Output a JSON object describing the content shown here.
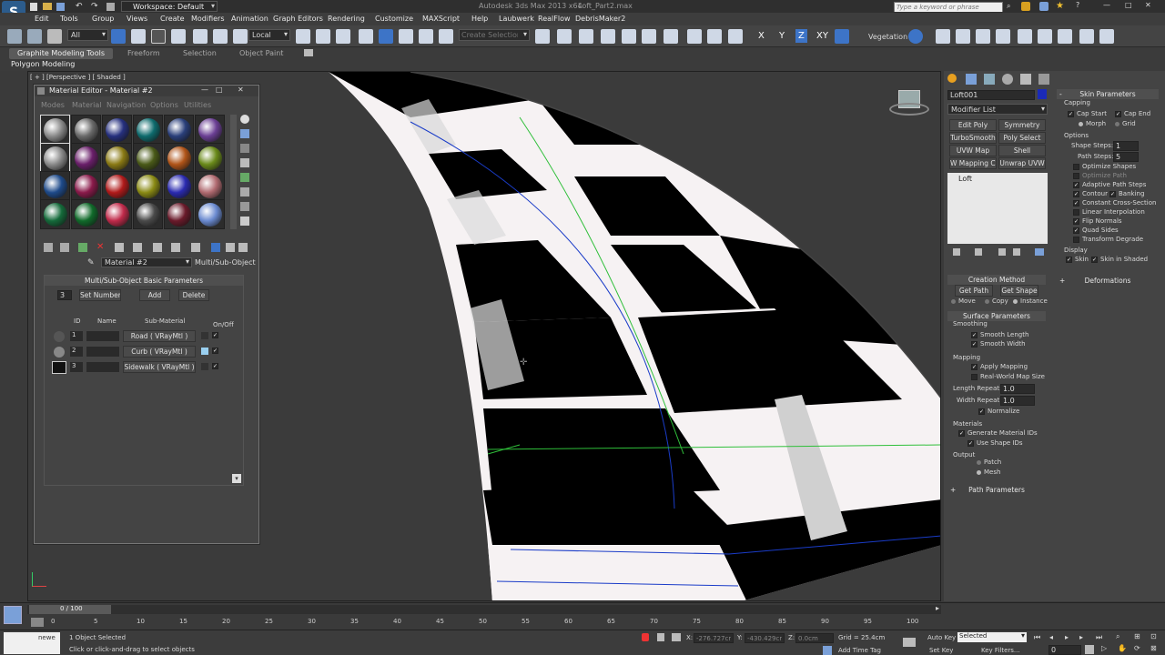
{
  "titlebar": {
    "workspace": "Workspace: Default",
    "app_title": "Autodesk 3ds Max  2013 x64",
    "file_name": "Loft_Part2.max",
    "search_placeholder": "Type a keyword or phrase"
  },
  "menu": [
    "Edit",
    "Tools",
    "Group",
    "Views",
    "Create",
    "Modifiers",
    "Animation",
    "Graph Editors",
    "Rendering",
    "Customize",
    "MAXScript",
    "Help",
    "Laubwerk",
    "RealFlow",
    "DebrisMaker2"
  ],
  "toolbar": {
    "selection_filter": "All",
    "ref_coord": "Local",
    "named_selection_placeholder": "Create Selection Se",
    "vegetation": "Vegetation",
    "axes": [
      "X",
      "Y",
      "Z",
      "XY"
    ]
  },
  "ribbon": {
    "tabs": [
      "Graphite Modeling Tools",
      "Freeform",
      "Selection",
      "Object Paint"
    ],
    "sub": "Polygon Modeling"
  },
  "viewport": {
    "label": "[ + ] [Perspective ] [ Shaded ]",
    "colors": {
      "dark": "#000000",
      "light": "#f6f2f3",
      "wire_blue": "#1a3cc8",
      "wire_green": "#2fbf3a"
    }
  },
  "material_editor": {
    "title": "Material Editor - Material #2",
    "menus": [
      "Modes",
      "Material",
      "Navigation",
      "Options",
      "Utilities"
    ],
    "material_name": "Material #2",
    "material_type": "Multi/Sub-Object",
    "rollout": "Multi/Sub-Object Basic Parameters",
    "count": "3",
    "set_number": "Set Number",
    "add": "Add",
    "delete": "Delete",
    "headers": {
      "id": "ID",
      "name": "Name",
      "sub": "Sub-Material",
      "onoff": "On/Off"
    },
    "rows": [
      {
        "id": "1",
        "sub": "Road  ( VRayMtl )"
      },
      {
        "id": "2",
        "sub": "Curb  ( VRayMtl )"
      },
      {
        "id": "3",
        "sub": "Sidewalk  ( VRayMtl )"
      }
    ],
    "swatches": [
      "#8a8a8a",
      "#6a6a6a",
      "#26307e",
      "#0e6b6d",
      "#2a3f7a",
      "#6b3f94",
      "#8a8a8a",
      "#6a1f6a",
      "#8a7a14",
      "#4a5a18",
      "#b05418",
      "#6a8a1a",
      "#1e4a8a",
      "#8a1a4a",
      "#b01a1a",
      "#8a8a14",
      "#2a2ab0",
      "#b06a70",
      "#146a3a",
      "#106a2a",
      "#c02a4a",
      "#4a4a4a",
      "#6a1a2a",
      "#6a8ad0"
    ]
  },
  "command_panel": {
    "object_name": "Loft001",
    "modifier_list": "Modifier List",
    "buttons": [
      "Edit Poly",
      "Symmetry",
      "TurboSmooth",
      "Poly Select",
      "UVW Map",
      "Shell",
      "W Mapping Cle",
      "Unwrap UVW"
    ],
    "stack_item": "Loft",
    "creation_method": "Creation Method",
    "get_path": "Get Path",
    "get_shape": "Get Shape",
    "move": "Move",
    "copy": "Copy",
    "instance": "Instance",
    "surface_params": "Surface Parameters",
    "smoothing": "Smoothing",
    "smooth_length": "Smooth Length",
    "smooth_width": "Smooth Width",
    "mapping": "Mapping",
    "apply_mapping": "Apply Mapping",
    "real_world": "Real-World Map Size",
    "length_repeat_label": "Length Repeat:",
    "length_repeat": "1.0",
    "width_repeat_label": "Width Repeat:",
    "width_repeat": "1.0",
    "normalize": "Normalize",
    "materials": "Materials",
    "gen_mat_ids": "Generate Material IDs",
    "use_shape_ids": "Use Shape IDs",
    "output": "Output",
    "patch": "Patch",
    "mesh": "Mesh",
    "path_params": "Path Parameters",
    "skin_params": "Skin Parameters",
    "capping": "Capping",
    "cap_start": "Cap Start",
    "cap_end": "Cap End",
    "morph": "Morph",
    "grid": "Grid",
    "options": "Options",
    "shape_steps_label": "Shape Steps:",
    "shape_steps": "1",
    "path_steps_label": "Path Steps:",
    "path_steps": "5",
    "opt_items": [
      "Optimize Shapes",
      "Optimize Path",
      "Adaptive Path Steps",
      "Contour",
      "Banking",
      "Constant Cross-Section",
      "Linear Interpolation",
      "Flip Normals",
      "Quad Sides",
      "Transform Degrade"
    ],
    "display": "Display",
    "skin": "Skin",
    "skin_in_shaded": "Skin in Shaded",
    "deformations": "Deformations"
  },
  "timeline": {
    "frame": "0 / 100",
    "ticks": [
      "0",
      "5",
      "10",
      "15",
      "20",
      "25",
      "30",
      "35",
      "40",
      "45",
      "50",
      "55",
      "60",
      "65",
      "70",
      "75",
      "80",
      "85",
      "90",
      "95",
      "100"
    ]
  },
  "status": {
    "objects_selected": "1 Object Selected",
    "prompt": "Click or click-and-drag to select objects",
    "x_label": "X:",
    "x": "-276.727cr",
    "y_label": "Y:",
    "y": "-430.429cr",
    "z_label": "Z:",
    "z": "0.0cm",
    "grid": "Grid = 25.4cm",
    "add_time_tag": "Add Time Tag",
    "auto_key": "Auto Key",
    "selected": "Selected",
    "set_key": "Set Key",
    "key_filters": "Key Filters...",
    "frame_num": "0",
    "script": "newe"
  }
}
